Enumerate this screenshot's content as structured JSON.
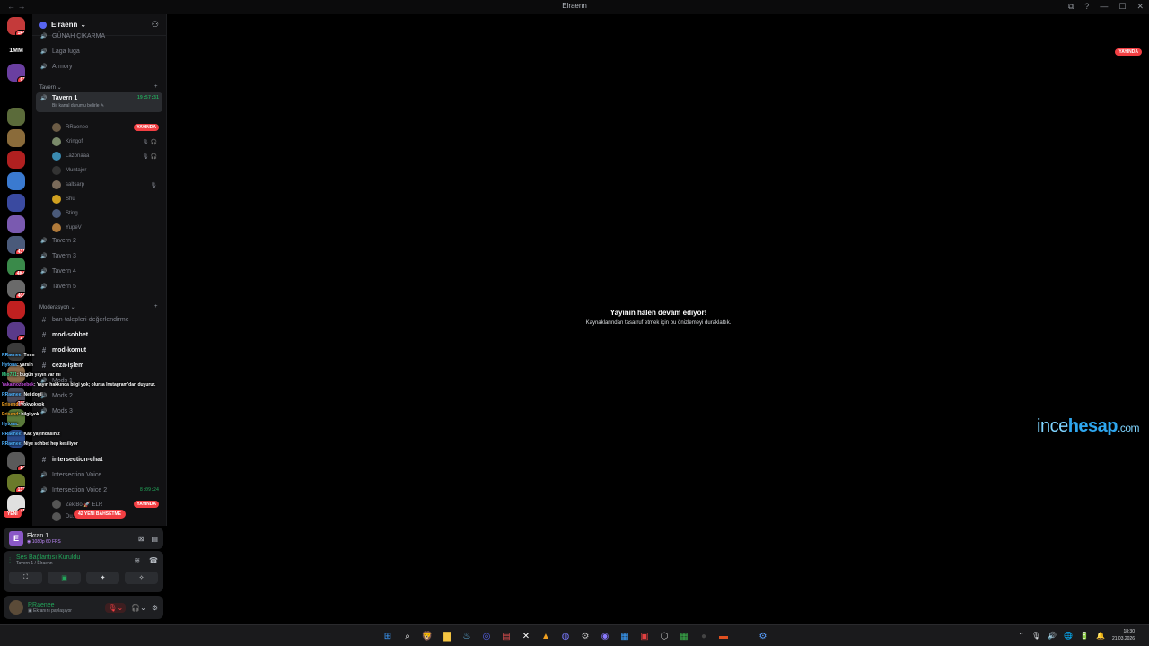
{
  "window": {
    "title": "Elraenn",
    "nav": "← →",
    "controls": [
      "⧉",
      "?",
      "—",
      "☐",
      "✕"
    ]
  },
  "rail": [
    {
      "label": "",
      "badge": "1k+",
      "color": "#c43a3a",
      "icon": "server-icon"
    },
    {
      "label": "1MM",
      "badge": "",
      "color": "#000000",
      "icon": "server-icon"
    },
    {
      "label": "",
      "badge": "63",
      "color": "#6a3fa0",
      "icon": "server-icon"
    },
    {
      "label": "",
      "badge": "",
      "color": "#000000",
      "icon": "server-icon"
    },
    {
      "label": "",
      "badge": "",
      "color": "#5b6b3a",
      "icon": "server-icon"
    },
    {
      "label": "",
      "badge": "",
      "color": "#8a6b3a",
      "icon": "server-icon"
    },
    {
      "label": "",
      "badge": "",
      "color": "#b02020",
      "icon": "server-icon"
    },
    {
      "label": "",
      "badge": "",
      "color": "#3a7ad0",
      "icon": "server-icon"
    },
    {
      "label": "",
      "badge": "",
      "color": "#3a4aa0",
      "icon": "server-icon"
    },
    {
      "label": "",
      "badge": "",
      "color": "#7a5ab0",
      "icon": "server-icon"
    },
    {
      "label": "",
      "badge": "431",
      "color": "#4a5a7a",
      "icon": "server-icon"
    },
    {
      "label": "",
      "badge": "4K+",
      "color": "#3a8a4a",
      "icon": "server-icon"
    },
    {
      "label": "",
      "badge": "404",
      "color": "#6a6a6a",
      "icon": "server-icon"
    },
    {
      "label": "",
      "badge": "",
      "color": "#c02020",
      "icon": "server-icon"
    },
    {
      "label": "",
      "badge": "22",
      "color": "#5a3a8a",
      "icon": "server-icon"
    },
    {
      "label": "",
      "badge": "",
      "color": "#3a3a3a",
      "icon": "server-icon"
    },
    {
      "label": "",
      "badge": "",
      "color": "#8a6a4a",
      "icon": "server-icon"
    },
    {
      "label": "",
      "badge": "248",
      "color": "#4a4a5a",
      "icon": "server-icon"
    },
    {
      "label": "",
      "badge": "",
      "color": "#5a7a3a",
      "icon": "server-icon"
    },
    {
      "label": "",
      "badge": "",
      "color": "#2a4a8a",
      "icon": "server-icon"
    },
    {
      "label": "",
      "badge": "24",
      "color": "#5a5a5a",
      "icon": "server-icon"
    },
    {
      "label": "",
      "badge": "137",
      "color": "#6a7a2a",
      "icon": "server-icon"
    },
    {
      "label": "",
      "badge": "41",
      "color": "#e0e0e0",
      "icon": "server-icon"
    }
  ],
  "server": {
    "name": "Elraenn",
    "chevron": "⌄"
  },
  "channels_top": [
    {
      "name": "GÜNAH ÇIKARMA",
      "type": "voice"
    },
    {
      "name": "Laga luga",
      "type": "voice"
    },
    {
      "name": "Armory",
      "type": "voice"
    }
  ],
  "cat_tavern": "Tavern ⌄",
  "tavern1": {
    "name": "Tavern 1",
    "time": "19:57:31",
    "sub": "Bir kanal durumu belirle ✎"
  },
  "users": [
    {
      "name": "RRaenee",
      "live": "YAYINDA",
      "icons": "🎙"
    },
    {
      "name": "Kringof",
      "live": "",
      "icons": "🎙 🎧"
    },
    {
      "name": "Lazonaaa",
      "live": "",
      "icons": "🎙 🎧"
    },
    {
      "name": "Muntajer",
      "live": "",
      "icons": ""
    },
    {
      "name": "saltsarp",
      "live": "",
      "icons": "🎙"
    },
    {
      "name": "Shu",
      "live": "",
      "icons": ""
    },
    {
      "name": "Sting",
      "live": "",
      "icons": ""
    },
    {
      "name": "YupeV",
      "live": "",
      "icons": ""
    }
  ],
  "taverns": [
    "Tavern 2",
    "Tavern 3",
    "Tavern 4",
    "Tavern 5"
  ],
  "cat_mod": "Moderasyon ⌄",
  "mod_channels": [
    {
      "name": "ban-talepleri-değerlendirme",
      "bright": false
    },
    {
      "name": "mod-sohbet",
      "bright": true
    },
    {
      "name": "mod-komut",
      "bright": true
    },
    {
      "name": "ceza-işlem",
      "bright": true
    },
    {
      "name": "Mods 1",
      "bright": false
    },
    {
      "name": "Mods 2",
      "bright": false
    },
    {
      "name": "Mods 3",
      "bright": false
    }
  ],
  "intersection": [
    {
      "name": "intersection-chat",
      "type": "text",
      "bright": true
    },
    {
      "name": "Intersection Voice",
      "type": "voice",
      "bright": false
    },
    {
      "name": "Intersection Voice 2",
      "type": "voice",
      "bright": false,
      "time": "8:09:24"
    }
  ],
  "inter_users": [
    {
      "name": "ZekiBo 🚀 ELR",
      "live": "YAYINDA"
    },
    {
      "name": "Du...",
      "live": ""
    }
  ],
  "overlay": [
    {
      "name": "RRaenee",
      "sep": ": ",
      "text": "Tmm",
      "cls": ""
    },
    {
      "name": "Hytona",
      "sep": ": ",
      "text": "yarsin",
      "cls": ""
    },
    {
      "name": "Mio731",
      "sep": ": ",
      "text": "bugün yayın var mı",
      "cls": "g"
    },
    {
      "name": "Yakamozbebek",
      "sep": ": ",
      "text": "Yayın hakkında bilgi yok; olursa Instagram'dan duyurur.",
      "cls": "p"
    },
    {
      "name": "RRaenee",
      "sep": ": ",
      "text": "Nei dogil",
      "cls": ""
    },
    {
      "name": "Erisend",
      "sep": ": ",
      "text": "yokyokyok",
      "cls": "o"
    },
    {
      "name": "Erisend",
      "sep": ": ",
      "text": "bilgi yok",
      "cls": "o"
    },
    {
      "name": "Hytona",
      "sep": ": ",
      "text": "",
      "cls": ""
    },
    {
      "name": "RRaenee",
      "sep": ": ",
      "text": "Kaç yayındasınız",
      "cls": ""
    },
    {
      "name": "RRaenee",
      "sep": ": ",
      "text": "Niye sohbet hep kesiliyor",
      "cls": ""
    }
  ],
  "new_pill": "YENİ",
  "mention_pill": "42 YENİ BAHSETME",
  "screen": {
    "letter": "E",
    "title": "Ekran 1",
    "sub": "◉ 1080p 60 FPS"
  },
  "voice": {
    "title": "Ses Bağlantısı Kuruldu",
    "sub": "Tavern 1 / Elraenn"
  },
  "voice_buttons": [
    "⛶",
    "▣",
    "✦",
    "✧"
  ],
  "me": {
    "name": "RRaenee",
    "status": "▣ Ekranını paylaşıyor"
  },
  "main": {
    "live": "YAYINDA",
    "title": "Yayının halen devam ediyor!",
    "subtitle": "Kaynaklarından tasarruf etmek için bu önizlemeyi duraklattık."
  },
  "watermark": {
    "a": "ince",
    "b": "hesap",
    "c": ".com"
  },
  "taskbar": [
    {
      "icon": "⊞",
      "color": "#3b9cff"
    },
    {
      "icon": "⌕",
      "color": "#ffffff"
    },
    {
      "icon": "🦁",
      "color": "#ff5a1f"
    },
    {
      "icon": "▇",
      "color": "#f5c542"
    },
    {
      "icon": "♨",
      "color": "#66c0f4"
    },
    {
      "icon": "◎",
      "color": "#5865f2"
    },
    {
      "icon": "▤",
      "color": "#e05050"
    },
    {
      "icon": "✕",
      "color": "#ffffff"
    },
    {
      "icon": "▲",
      "color": "#f0a020"
    },
    {
      "icon": "◍",
      "color": "#7a7aff"
    },
    {
      "icon": "⚙",
      "color": "#c0c0c0"
    },
    {
      "icon": "◉",
      "color": "#8a7aff"
    },
    {
      "icon": "▦",
      "color": "#3aa0ff"
    },
    {
      "icon": "▣",
      "color": "#e04040"
    },
    {
      "icon": "⬡",
      "color": "#c0c0c0"
    },
    {
      "icon": "▦",
      "color": "#3ab04a"
    },
    {
      "icon": "●",
      "color": "#444444"
    },
    {
      "icon": "▬",
      "color": "#e05020"
    },
    {
      "icon": "⚙",
      "color": "#5aa0ff"
    }
  ],
  "clock": {
    "time": "18:30",
    "date": "21.03.2026"
  },
  "tray_icons": [
    "⌃",
    "🎙",
    "🔊",
    "🌐",
    "🔋",
    "🔔"
  ]
}
